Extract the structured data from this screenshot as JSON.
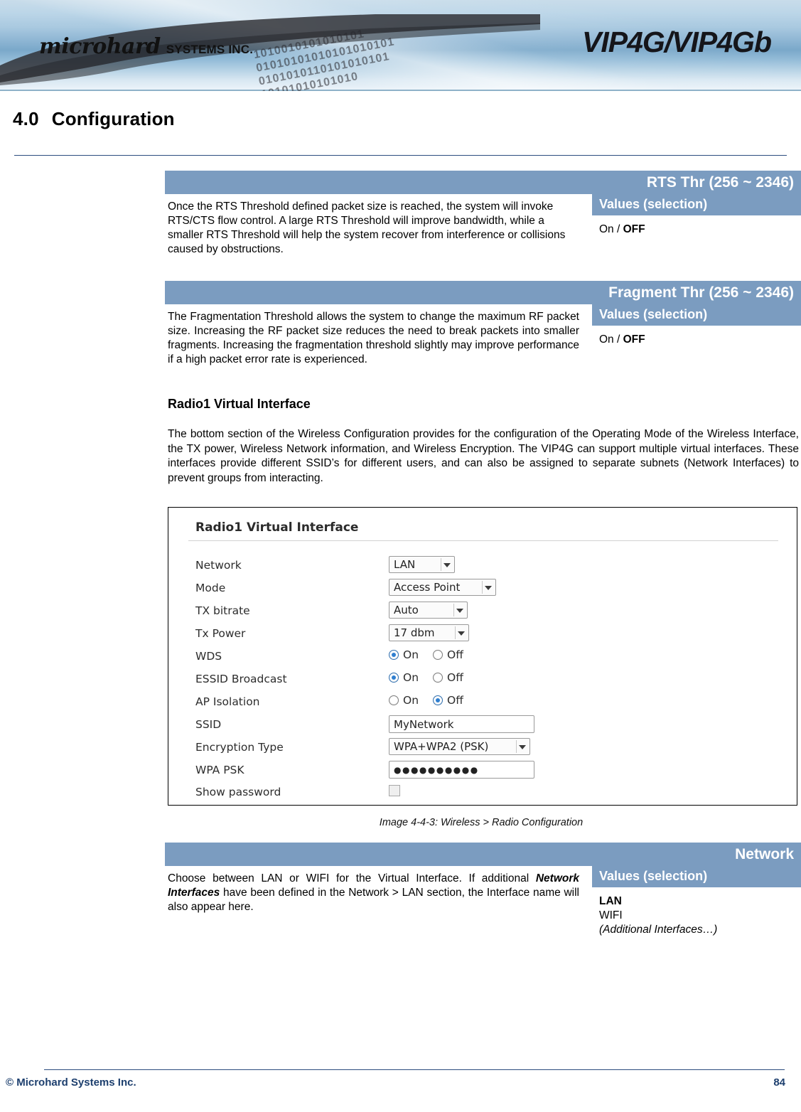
{
  "header": {
    "logo_main": "microhard",
    "logo_sub": "SYSTEMS INC.",
    "product": "VIP4G/VIP4Gb",
    "digits_line1": "1010010101010101",
    "digits_line2": "01010101010101010101",
    "digits_line3": "0101010110101010101",
    "digits_line4": "10101010101010"
  },
  "page": {
    "section_number": "4.0",
    "section_title": "Configuration"
  },
  "blocks": [
    {
      "title": "RTS Thr (256 ~ 2346)",
      "description": "Once the RTS Threshold defined packet size is reached, the system will invoke RTS/CTS flow control. A large RTS Threshold will improve bandwidth, while a smaller RTS Threshold will help the system recover from interference or collisions caused by obstructions.",
      "values_header": "Values (selection)",
      "value_normal": "On / ",
      "value_bold": "OFF"
    },
    {
      "title": "Fragment Thr  (256 ~ 2346)",
      "description": "The Fragmentation Threshold allows the system to change the maximum RF packet size. Increasing the RF packet size reduces the need to break packets into smaller fragments.  Increasing the fragmentation threshold slightly may improve performance if a high packet error rate is experienced.",
      "values_header": "Values (selection)",
      "value_normal": "On / ",
      "value_bold": "OFF"
    }
  ],
  "radio_virtual": {
    "heading": "Radio1 Virtual Interface",
    "paragraph": "The bottom section of the Wireless Configuration provides for the configuration of the Operating Mode of the Wireless Interface, the TX power, Wireless Network information, and Wireless Encryption. The VIP4G can support multiple virtual interfaces. These interfaces provide different SSID’s for different users, and can also be assigned to separate subnets (Network Interfaces) to prevent groups from interacting."
  },
  "figure": {
    "title": "Radio1 Virtual Interface",
    "caption": "Image 4-4-3:  Wireless  > Radio Configuration",
    "rows": {
      "network_label": "Network",
      "network_value": "LAN",
      "mode_label": "Mode",
      "mode_value": "Access Point",
      "tx_bitrate_label": "TX bitrate",
      "tx_bitrate_value": "Auto",
      "tx_power_label": "Tx Power",
      "tx_power_value": "17 dbm",
      "wds_label": "WDS",
      "essid_label": "ESSID Broadcast",
      "ap_isolation_label": "AP Isolation",
      "ssid_label": "SSID",
      "ssid_value": "MyNetwork",
      "encryption_label": "Encryption Type",
      "encryption_value": "WPA+WPA2 (PSK)",
      "wpa_psk_label": "WPA PSK",
      "wpa_psk_value": "●●●●●●●●●●",
      "show_password_label": "Show password",
      "on_label": "On",
      "off_label": "Off"
    }
  },
  "network_block": {
    "title": "Network",
    "description_part1": "Choose between LAN or WIFI for the Virtual Interface. If additional ",
    "description_bold_italic": "Network Interfaces",
    "description_part2": " have been defined in the Network > LAN section, the Interface name will also appear here.",
    "values_header": "Values (selection)",
    "values": [
      {
        "text": "LAN",
        "style": "bold"
      },
      {
        "text": "WIFI",
        "style": "normal"
      },
      {
        "text": "(Additional Interfaces…)",
        "style": "italic"
      }
    ]
  },
  "footer": {
    "copyright": "© Microhard Systems Inc.",
    "page_number": "84"
  }
}
